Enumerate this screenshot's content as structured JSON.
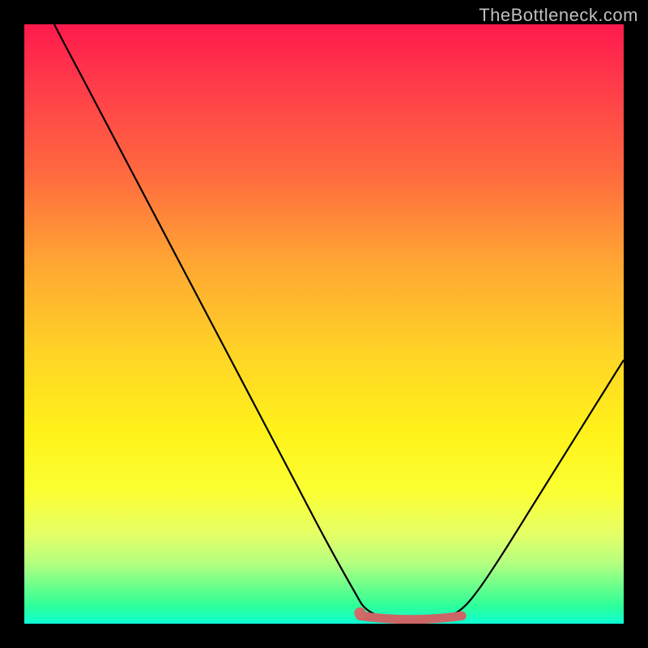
{
  "watermark": "TheBottleneck.com",
  "colors": {
    "curve": "#000000",
    "marker": "#cc6666",
    "marker_fill": "#d26a6a",
    "background_top": "#ff1a4d",
    "background_bottom": "#0affd9"
  },
  "chart_data": {
    "type": "line",
    "title": "",
    "xlabel": "",
    "ylabel": "",
    "xlim": [
      0,
      100
    ],
    "ylim": [
      0,
      100
    ],
    "grid": false,
    "series": [
      {
        "name": "bottleneck-curve",
        "x": [
          0,
          5,
          10,
          15,
          20,
          25,
          30,
          35,
          40,
          45,
          50,
          55,
          57,
          60,
          63,
          66,
          70,
          73,
          76,
          80,
          85,
          90,
          95,
          100
        ],
        "y": [
          110,
          100,
          90.5,
          81,
          71.5,
          62,
          52.5,
          43,
          33.5,
          24,
          14.5,
          5.5,
          2.5,
          1.0,
          0.6,
          0.6,
          1.0,
          2.5,
          6,
          12,
          20,
          28,
          36,
          44
        ]
      }
    ],
    "highlight_segment": {
      "name": "optimal-range",
      "x_start": 56,
      "x_end": 73,
      "y": 0.9
    },
    "marker_point": {
      "x": 56,
      "y": 1.8
    }
  }
}
